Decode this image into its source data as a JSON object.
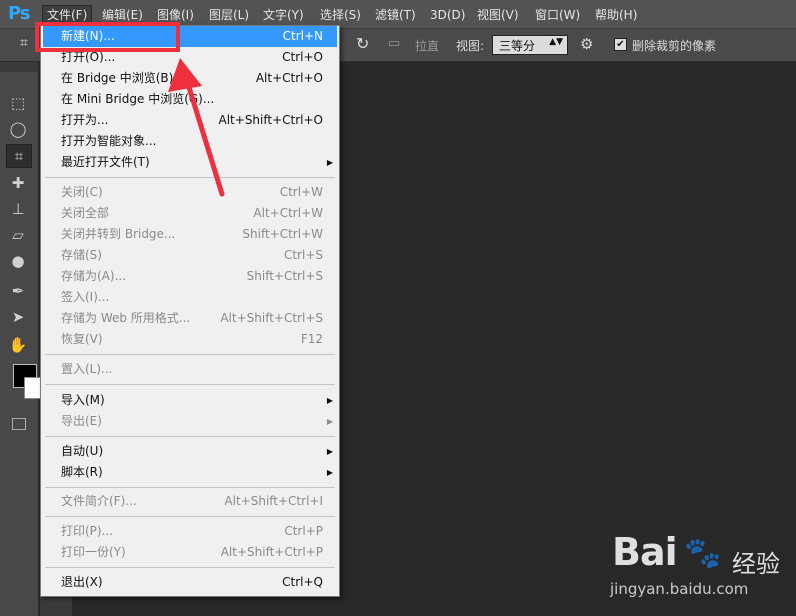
{
  "app": {
    "logo": "Ps"
  },
  "menubar": {
    "items": [
      "文件(F)",
      "编辑(E)",
      "图像(I)",
      "图层(L)",
      "文字(Y)",
      "选择(S)",
      "滤镜(T)",
      "3D(D)",
      "视图(V)",
      "窗口(W)",
      "帮助(H)"
    ]
  },
  "options": {
    "straighten_label": "拉直",
    "view_label": "视图:",
    "view_value": "三等分",
    "delete_cropped_label": "删除裁剪的像素",
    "delete_cropped_checked": "✔"
  },
  "file_menu": {
    "items": [
      {
        "label": "新建(N)...",
        "shortcut": "Ctrl+N"
      },
      {
        "label": "打开(O)...",
        "shortcut": "Ctrl+O"
      },
      {
        "label": "在 Bridge 中浏览(B)...",
        "shortcut": "Alt+Ctrl+O"
      },
      {
        "label": "在 Mini Bridge 中浏览(G)...",
        "shortcut": ""
      },
      {
        "label": "打开为...",
        "shortcut": "Alt+Shift+Ctrl+O"
      },
      {
        "label": "打开为智能对象...",
        "shortcut": ""
      },
      {
        "label": "最近打开文件(T)",
        "shortcut": ""
      },
      {
        "label": "关闭(C)",
        "shortcut": "Ctrl+W"
      },
      {
        "label": "关闭全部",
        "shortcut": "Alt+Ctrl+W"
      },
      {
        "label": "关闭并转到 Bridge...",
        "shortcut": "Shift+Ctrl+W"
      },
      {
        "label": "存储(S)",
        "shortcut": "Ctrl+S"
      },
      {
        "label": "存储为(A)...",
        "shortcut": "Shift+Ctrl+S"
      },
      {
        "label": "签入(I)...",
        "shortcut": ""
      },
      {
        "label": "存储为 Web 所用格式...",
        "shortcut": "Alt+Shift+Ctrl+S"
      },
      {
        "label": "恢复(V)",
        "shortcut": "F12"
      },
      {
        "label": "置入(L)...",
        "shortcut": ""
      },
      {
        "label": "导入(M)",
        "shortcut": ""
      },
      {
        "label": "导出(E)",
        "shortcut": ""
      },
      {
        "label": "自动(U)",
        "shortcut": ""
      },
      {
        "label": "脚本(R)",
        "shortcut": ""
      },
      {
        "label": "文件简介(F)...",
        "shortcut": "Alt+Shift+Ctrl+I"
      },
      {
        "label": "打印(P)...",
        "shortcut": "Ctrl+P"
      },
      {
        "label": "打印一份(Y)",
        "shortcut": "Alt+Shift+Ctrl+P"
      },
      {
        "label": "退出(X)",
        "shortcut": "Ctrl+Q"
      }
    ]
  },
  "watermark": {
    "brand": "Bai",
    "brand2": "经验",
    "url": "jingyan.baidu.com"
  },
  "colors": {
    "highlight": "#3399ff",
    "annotation": "#ee2f3d",
    "menu_bg": "#f0f0f0"
  }
}
